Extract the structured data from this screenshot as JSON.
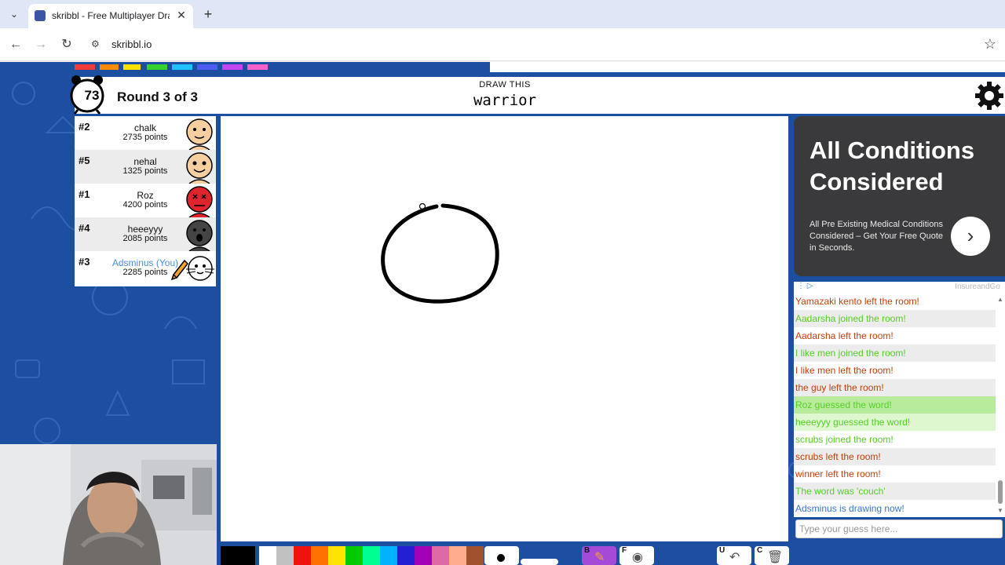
{
  "browser": {
    "tab_title": "skribbl - Free Multiplayer Drawing",
    "url": "skribbl.io",
    "icons": [
      "tab-dropdown-icon",
      "close-icon",
      "plus-icon",
      "back-icon",
      "forward-icon",
      "reload-icon",
      "site-info-icon",
      "star-icon"
    ]
  },
  "header": {
    "timer": "73",
    "round": "Round 3 of 3",
    "draw_label": "DRAW THIS",
    "word": "warrior"
  },
  "players": [
    {
      "rank": "#2",
      "name": "chalk",
      "points": "2735 points",
      "avatar_color": "#f5cfa0"
    },
    {
      "rank": "#5",
      "name": "nehal",
      "points": "1325 points",
      "avatar_color": "#f5cfa0"
    },
    {
      "rank": "#1",
      "name": "Roz",
      "points": "4200 points",
      "avatar_color": "#e0242d"
    },
    {
      "rank": "#4",
      "name": "heeeyyy",
      "points": "2085 points",
      "avatar_color": "#444444"
    },
    {
      "rank": "#3",
      "name": "Adsminus (You)",
      "points": "2285 points",
      "avatar_color": "#ffffff"
    }
  ],
  "ad": {
    "headline": "All Conditions Considered",
    "body": "All Pre Existing Medical Conditions Considered – Get Your Free Quote in Seconds.",
    "brand": "InsureandGo",
    "arrow": "›"
  },
  "chat": {
    "messages": [
      {
        "text": "Yamazaki kento left the room!",
        "type": "red"
      },
      {
        "text": "Aadarsha joined the room!",
        "type": "green"
      },
      {
        "text": "Aadarsha left the room!",
        "type": "red"
      },
      {
        "text": "I like men joined the room!",
        "type": "green"
      },
      {
        "text": "I like men left the room!",
        "type": "red"
      },
      {
        "text": "the guy left the room!",
        "type": "red"
      },
      {
        "text": "Roz guessed the word!",
        "type": "guess"
      },
      {
        "text": "heeeyyy guessed the word!",
        "type": "guess2"
      },
      {
        "text": "scrubs joined the room!",
        "type": "green"
      },
      {
        "text": "scrubs left the room!",
        "type": "red"
      },
      {
        "text": "winner left the room!",
        "type": "red"
      },
      {
        "text": "The word was 'couch'",
        "type": "green"
      },
      {
        "text": "Adsminus is drawing now!",
        "type": "blue"
      }
    ],
    "placeholder": "Type your guess here..."
  },
  "palette": [
    "#ffffff",
    "#c1c1c1",
    "#ef130b",
    "#ff7100",
    "#ffe400",
    "#00cc00",
    "#00ff91",
    "#00b2ff",
    "#231fd3",
    "#a300ba",
    "#df69a7",
    "#ffac8e",
    "#a0522d"
  ],
  "current_color": "#000000",
  "tools": [
    {
      "key": "B",
      "name": "brush",
      "active": true
    },
    {
      "key": "F",
      "name": "fill",
      "active": false
    },
    {
      "key": "U",
      "name": "undo",
      "active": false
    },
    {
      "key": "C",
      "name": "clear",
      "active": false
    }
  ],
  "colors": {
    "page_bg": "#1d4fa0",
    "accent": "#a54ad8"
  }
}
